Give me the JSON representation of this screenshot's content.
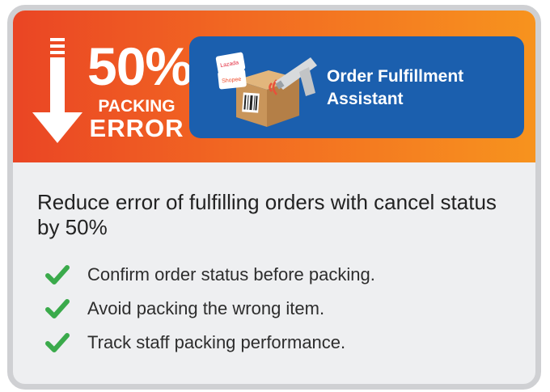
{
  "banner": {
    "percent": "50%",
    "label_line1": "PACKING",
    "label_line2": "ERROR",
    "arrow_icon": "down-arrow-icon",
    "colors": {
      "gradient_start": "#ea4524",
      "gradient_end": "#f7931e",
      "panel": "#1b5fae"
    }
  },
  "feature": {
    "title_line1": "Order Fulfillment",
    "title_line2": "Assistant",
    "illustration_icon": "barcode-scanner-box-icon",
    "tag_texts": [
      "Lazada",
      "Shopee"
    ]
  },
  "headline": "Reduce error of fulfilling orders with cancel status by 50%",
  "bullets": [
    {
      "icon": "check-icon",
      "text": "Confirm order status before packing."
    },
    {
      "icon": "check-icon",
      "text": "Avoid packing the wrong item."
    },
    {
      "icon": "check-icon",
      "text": "Track staff packing performance."
    }
  ],
  "colors": {
    "check": "#3aaa4b",
    "card_border": "#cfd0d3",
    "card_bg": "#eeeff1"
  }
}
